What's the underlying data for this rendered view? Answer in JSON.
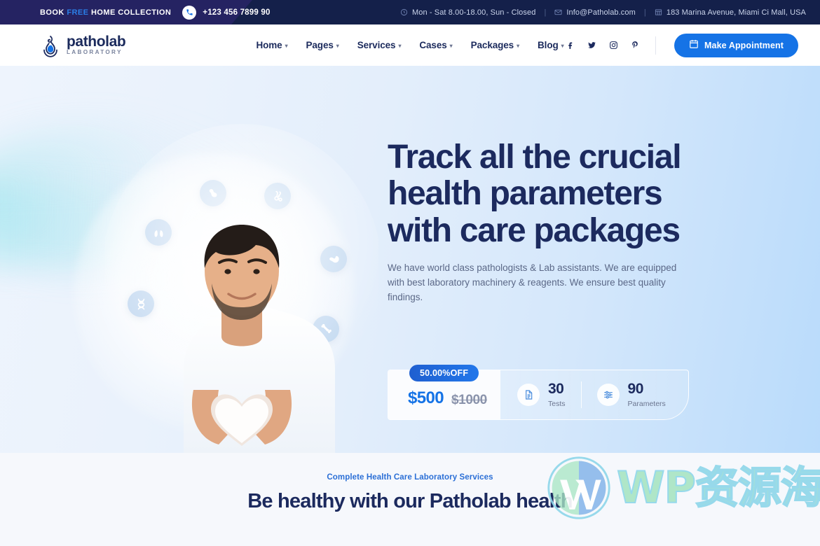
{
  "topbar": {
    "book_label": "BOOK",
    "free_label": "FREE",
    "collection_label": "HOME COLLECTION",
    "phone": "+123 456 7899 90",
    "hours": "Mon - Sat 8.00-18.00, Sun - Closed",
    "email": "Info@Patholab.com",
    "address": "183 Marina Avenue, Miami Ci Mall, USA",
    "sep": "|"
  },
  "header": {
    "logo_name": "patholab",
    "logo_sub": "LABORATORY",
    "nav": [
      {
        "label": "Home",
        "caret": "▾"
      },
      {
        "label": "Pages",
        "caret": "▾"
      },
      {
        "label": "Services",
        "caret": "▾"
      },
      {
        "label": "Cases",
        "caret": "▾"
      },
      {
        "label": "Packages",
        "caret": "▾"
      },
      {
        "label": "Blog",
        "caret": "▾"
      }
    ],
    "socials": [
      "facebook-icon",
      "twitter-icon",
      "instagram-icon",
      "pinterest-icon"
    ],
    "appointment_label": "Make Appointment"
  },
  "hero": {
    "title_line1": "Track all the crucial",
    "title_line2": "health parameters",
    "title_line3": "with care packages",
    "subtitle": "We have world class pathologists & Lab assistants. We are equipped with best laboratory machinery & reagents. We ensure best quality findings.",
    "offer_badge": "50.00%OFF",
    "price_now": "$500",
    "price_old": "$1000",
    "stats": [
      {
        "icon": "report-icon",
        "value": "30",
        "label": "Tests"
      },
      {
        "icon": "sliders-icon",
        "value": "90",
        "label": "Parameters"
      }
    ],
    "floating_icons": [
      "stomach-icon",
      "bone-joint-icon",
      "lungs-icon",
      "kidney-icon",
      "dna-icon",
      "bone-icon"
    ]
  },
  "lower": {
    "eyebrow": "Complete Health Care Laboratory Services",
    "title": "Be healthy with our Patholab health"
  },
  "watermark": {
    "text": "WP资源海"
  },
  "colors": {
    "brand_blue": "#1573e6",
    "navy": "#1c2a5e",
    "topbar_dark": "#14204a",
    "topbar_indigo": "#252362",
    "hero_bg_light": "#eef4fd",
    "hero_bg_deep": "#b9dbfb",
    "lower_bg": "#f6f8fc"
  }
}
